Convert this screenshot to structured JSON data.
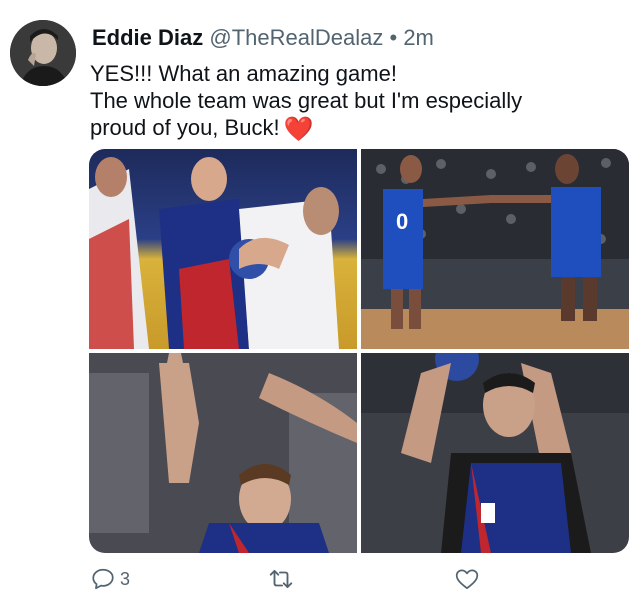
{
  "tweet": {
    "author_name": "Eddie Diaz",
    "handle": "@TheRealDealaz",
    "separator": "•",
    "time": "2m",
    "text_line1": "YES!!! What an amazing game!",
    "text_line2": "The whole team was great but I'm especially",
    "text_line3": "proud of you, Buck!",
    "emoji": "❤️"
  },
  "media": {
    "photos": [
      {
        "jersey_text": ""
      },
      {
        "jersey_text": "0"
      },
      {
        "jersey_text": ""
      },
      {
        "jersey_text": ""
      }
    ]
  },
  "actions": {
    "reply_count": "3",
    "retweet_count": "",
    "like_count": ""
  },
  "colors": {
    "text": "#0f1419",
    "secondary": "#536471",
    "heart": "#e0245e"
  },
  "icons": [
    "reply-icon",
    "retweet-icon",
    "like-icon"
  ]
}
